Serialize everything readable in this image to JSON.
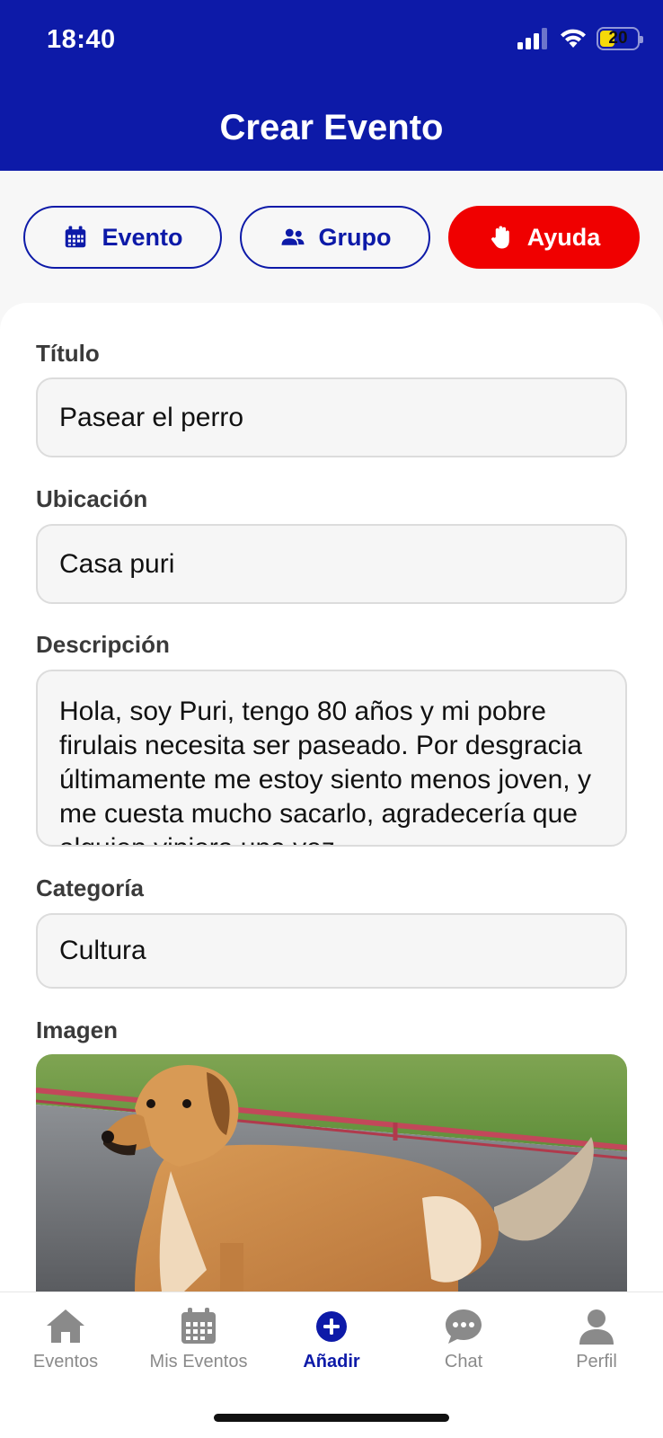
{
  "status_bar": {
    "time": "18:40",
    "battery": "20"
  },
  "header": {
    "title": "Crear Evento"
  },
  "tabs": [
    {
      "label": "Evento",
      "icon": "calendar-icon"
    },
    {
      "label": "Grupo",
      "icon": "group-icon"
    },
    {
      "label": "Ayuda",
      "icon": "hand-icon"
    }
  ],
  "form": {
    "titulo": {
      "label": "Título",
      "value": "Pasear el perro"
    },
    "ubicacion": {
      "label": "Ubicación",
      "value": "Casa puri"
    },
    "descripcion": {
      "label": "Descripción",
      "value": "Hola, soy Puri, tengo 80 años y mi pobre firulais necesita ser paseado. Por desgracia últimamente me estoy siento menos joven, y me cuesta mucho sacarlo, agradecería que alguien viniera una vez"
    },
    "categoria": {
      "label": "Categoría",
      "value": "Cultura"
    },
    "imagen": {
      "label": "Imagen"
    }
  },
  "bottom_nav": [
    {
      "label": "Eventos",
      "icon": "home-icon"
    },
    {
      "label": "Mis Eventos",
      "icon": "calendar-icon"
    },
    {
      "label": "Añadir",
      "icon": "add-circle-icon",
      "active": true
    },
    {
      "label": "Chat",
      "icon": "chat-icon"
    },
    {
      "label": "Perfil",
      "icon": "person-icon"
    }
  ],
  "colors": {
    "primary": "#0d1aa8",
    "help": "#f00000"
  }
}
